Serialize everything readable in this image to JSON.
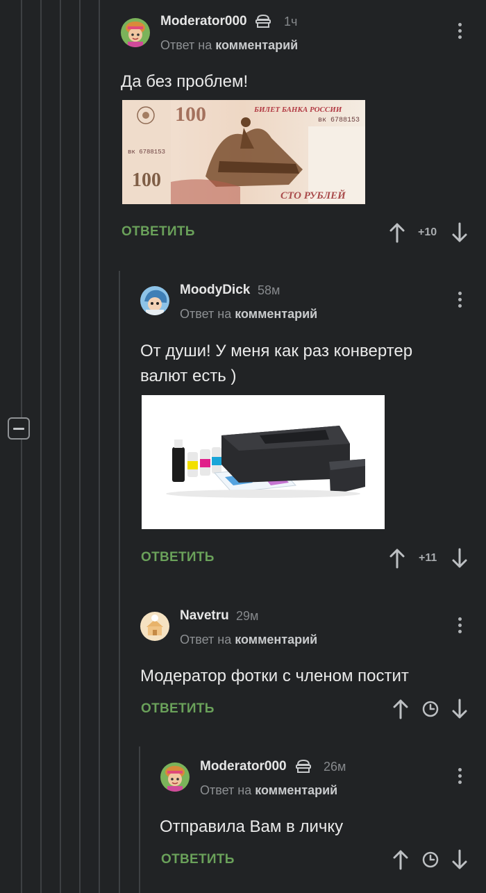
{
  "reply_to_prefix": "Ответ на",
  "reply_to_target": "комментарий",
  "reply_label": "ОТВЕТИТЬ",
  "comments": [
    {
      "username": "Moderator000",
      "time": "1ч",
      "has_moderator_badge": true,
      "text": "Да без проблем!",
      "rating": "+10",
      "image": {
        "type": "banknote",
        "header": "БИЛЕТ БАНКА РОССИИ",
        "denomination": "100",
        "serial": "вк 6788153",
        "words": "СТО РУБЛЕЙ"
      }
    },
    {
      "username": "MoodyDick",
      "time": "58м",
      "has_moderator_badge": false,
      "text": "От души! У меня как раз конвертер валют есть )",
      "rating": "+11",
      "image": {
        "type": "printer"
      }
    },
    {
      "username": "Navetru",
      "time": "29м",
      "has_moderator_badge": false,
      "text": "Модератор фотки с членом постит",
      "rating_icon": "clock-icon"
    },
    {
      "username": "Moderator000",
      "time": "26м",
      "has_moderator_badge": true,
      "text": "Отправила Вам в личку",
      "rating_icon": "clock-icon"
    }
  ],
  "colors": {
    "background": "#212325",
    "reply_green": "#6aa15a",
    "thread_line": "#3d4043",
    "muted_text": "#86898c"
  }
}
